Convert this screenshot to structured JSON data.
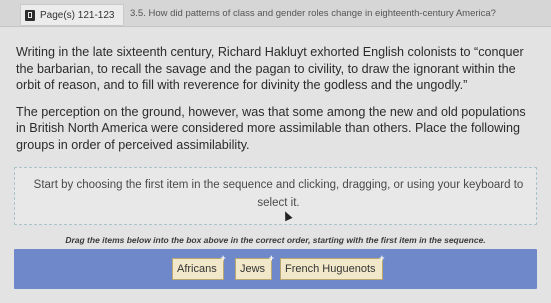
{
  "header": {
    "pages_label": "Page(s) 121-123",
    "question_title": "3.5. How did patterns of class and gender roles change in eighteenth-century America?"
  },
  "passage": {
    "paragraph1": "Writing in the late sixteenth century, Richard Hakluyt exhorted English colonists to “conquer the barbarian, to recall the savage and the pagan to civility, to draw the ignorant within the orbit of reason, and to fill with reverence for divinity the godless and the ungodly.”",
    "paragraph2": "The perception on the ground, however, was that some among the new and old populations in British North America were considered more assimilable than others. Place the following groups in order of perceived assimilability."
  },
  "drop_zone": {
    "instruction": "Start by choosing the first item in the sequence and clicking, dragging, or using your keyboard to select it."
  },
  "drag_instruction": "Drag the items below into the box above in the correct order, starting with the first item in the sequence.",
  "items": [
    {
      "label": "Africans",
      "marker": "+"
    },
    {
      "label": "Jews",
      "marker": "+"
    },
    {
      "label": "French Huguenots",
      "marker": "+"
    }
  ],
  "colors": {
    "tray": "#6f88c9",
    "item_bg": "#f1e8c9",
    "drop_border": "#a9c4c8"
  },
  "icons": {
    "pages_tab": "book-icon",
    "item_marker": "plus-icon",
    "cursor": "cursor-icon"
  }
}
